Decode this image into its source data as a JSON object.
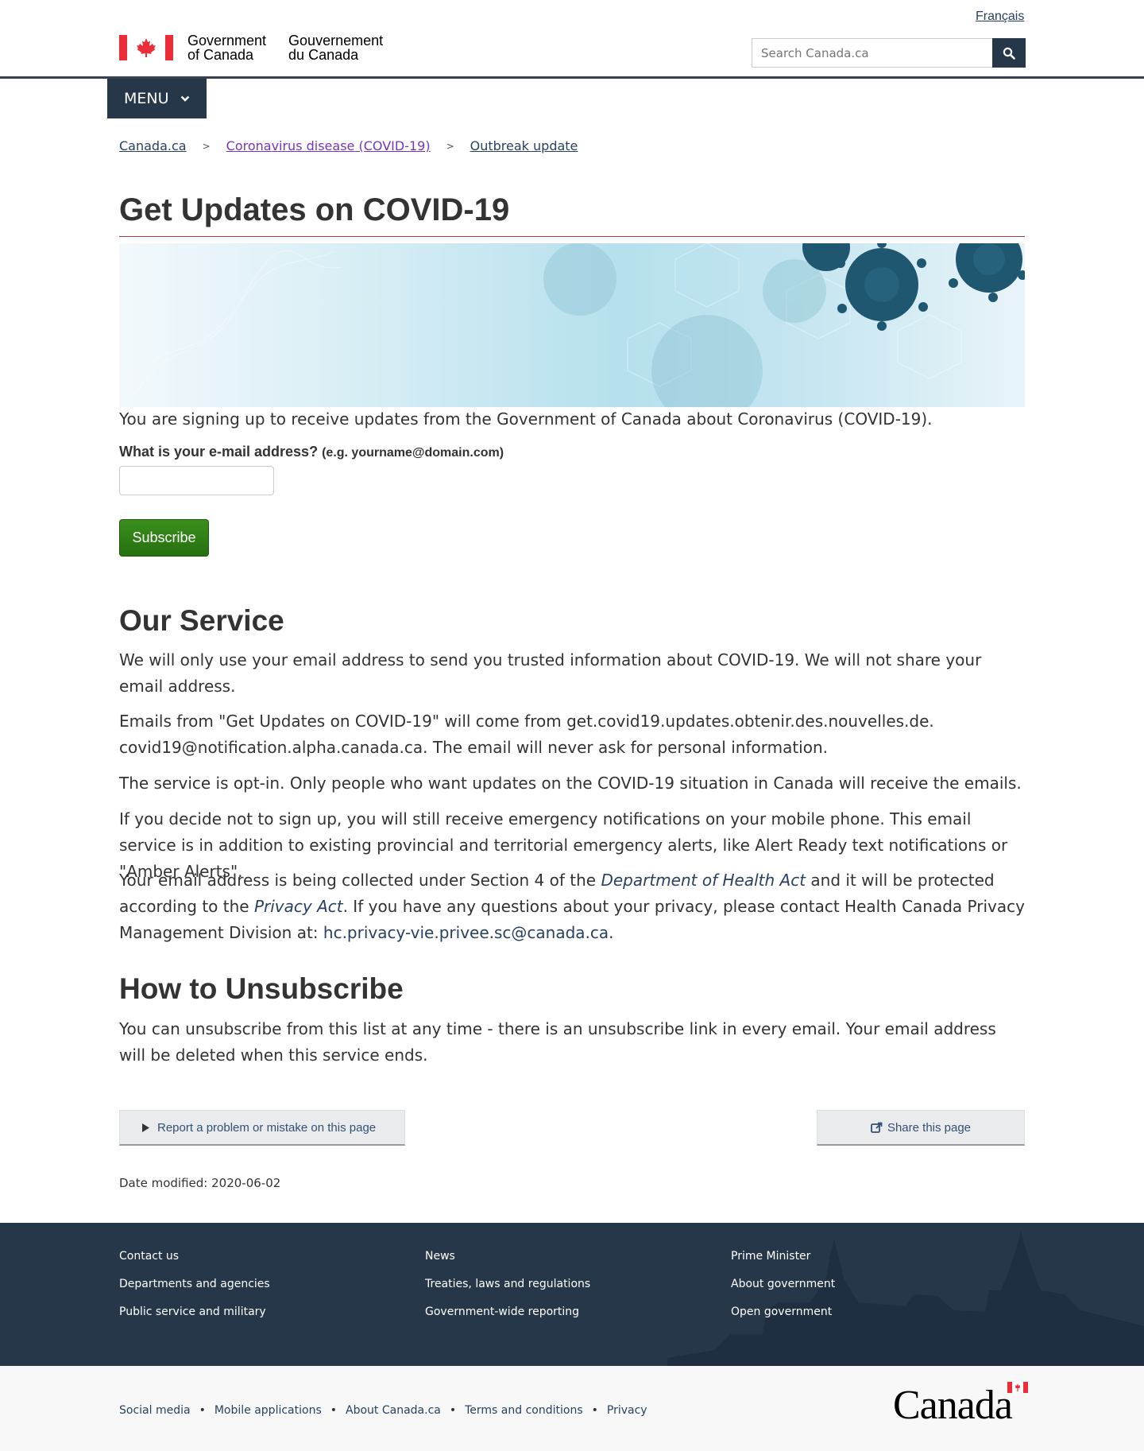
{
  "header": {
    "language_link": "Français",
    "brand_en": "Government\nof Canada",
    "brand_fr": "Gouvernement\ndu Canada",
    "search_placeholder": "Search Canada.ca",
    "menu_label": "MENU"
  },
  "breadcrumb": [
    "Canada.ca",
    "Coronavirus disease (COVID-19)",
    "Outbreak update"
  ],
  "main": {
    "title": "Get Updates on COVID-19",
    "intro": "You are signing up to receive updates from the Government of Canada about Coronavirus (COVID-19).",
    "email_label": "What is your e-mail address?",
    "email_hint": "(e.g. yourname@domain.com)",
    "subscribe_label": "Subscribe",
    "service_heading": "Our Service",
    "service_p1": "We will only use your email address to send you trusted information about COVID-19. We will not share your email address.",
    "service_p2": "Emails from \"Get Updates on COVID-19\" will come from get.covid19.updates.obtenir.des.nouvelles.de. covid19@notification.alpha.canada.ca. The email will never ask for personal information.",
    "service_p3": "The service is opt-in. Only people who want updates on the COVID-19 situation in Canada will receive the emails.",
    "service_p4": "If you decide not to sign up, you will still receive emergency notifications on your mobile phone. This email service is in addition to existing provincial and territorial emergency alerts, like Alert Ready text notifications or \"Amber Alerts\".",
    "privacy_p_start": "Your email address is being collected under Section 4 of the ",
    "privacy_link_health_act": "Department of Health Act",
    "privacy_p_mid": " and it will be protected according to the ",
    "privacy_link_privacy_act": "Privacy Act",
    "privacy_p_mid2": ". If you have any questions about your privacy, please contact Health Canada Privacy Management Division at: ",
    "privacy_email": "hc.privacy-vie.privee.sc@canada.ca",
    "privacy_p_end": ".",
    "unsubscribe_heading": "How to Unsubscribe",
    "unsubscribe_p": "You can unsubscribe from this list at any time - there is an unsubscribe link in every email. Your email address will be deleted when this service ends.",
    "report_label": "Report a problem or mistake on this page",
    "share_label": "Share this page",
    "date_modified": "Date modified: 2020-06-02"
  },
  "footer": {
    "col1": [
      "Contact us",
      "Departments and agencies",
      "Public service and military"
    ],
    "col2": [
      "News",
      "Treaties, laws and regulations",
      "Government-wide reporting"
    ],
    "col3": [
      "Prime Minister",
      "About government",
      "Open government"
    ],
    "bottom_links": [
      "Social media",
      "Mobile applications",
      "About Canada.ca",
      "Terms and conditions",
      "Privacy"
    ],
    "wordmark": "Canada"
  },
  "colors": {
    "header_dark": "#26374a",
    "flag_red": "#eb2d37",
    "title_rule": "#af3c43",
    "subscribe_green": "#2e8012",
    "visited_link": "#7834bc"
  }
}
